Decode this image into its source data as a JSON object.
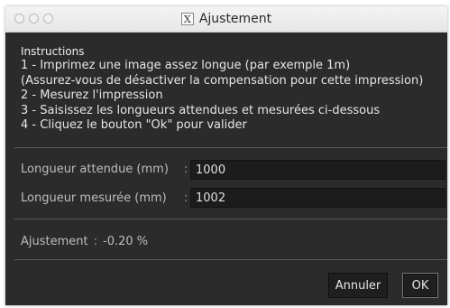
{
  "window": {
    "title": "Ajustement",
    "title_icon": "x11-icon",
    "title_icon_glyph": "X",
    "controls": [
      "close",
      "minimize",
      "zoom"
    ]
  },
  "instructions": {
    "heading": "Instructions",
    "lines": [
      "1 - Imprimez une image assez longue (par exemple 1m)",
      "(Assurez-vous de désactiver la compensation pour cette impression)",
      "2 - Mesurez l'impression",
      "3 - Saisissez les longueurs attendues et mesurées ci-dessous",
      "4 - Cliquez le bouton \"Ok\" pour valider"
    ]
  },
  "fields": {
    "expected_label": "Longueur attendue (mm)",
    "expected_value": "1000",
    "measured_label": "Longueur mesurée (mm)",
    "measured_value": "1002",
    "colon": ":"
  },
  "result": {
    "label": "Ajustement",
    "separator": ":",
    "value": "-0.20 %"
  },
  "buttons": {
    "cancel_label": "Annuler",
    "ok_label": "OK"
  },
  "colors": {
    "background": "#2b2b2b",
    "input_background": "#1c1c1c",
    "text": "#e6e6e6",
    "label_text": "#bdbdbd"
  }
}
